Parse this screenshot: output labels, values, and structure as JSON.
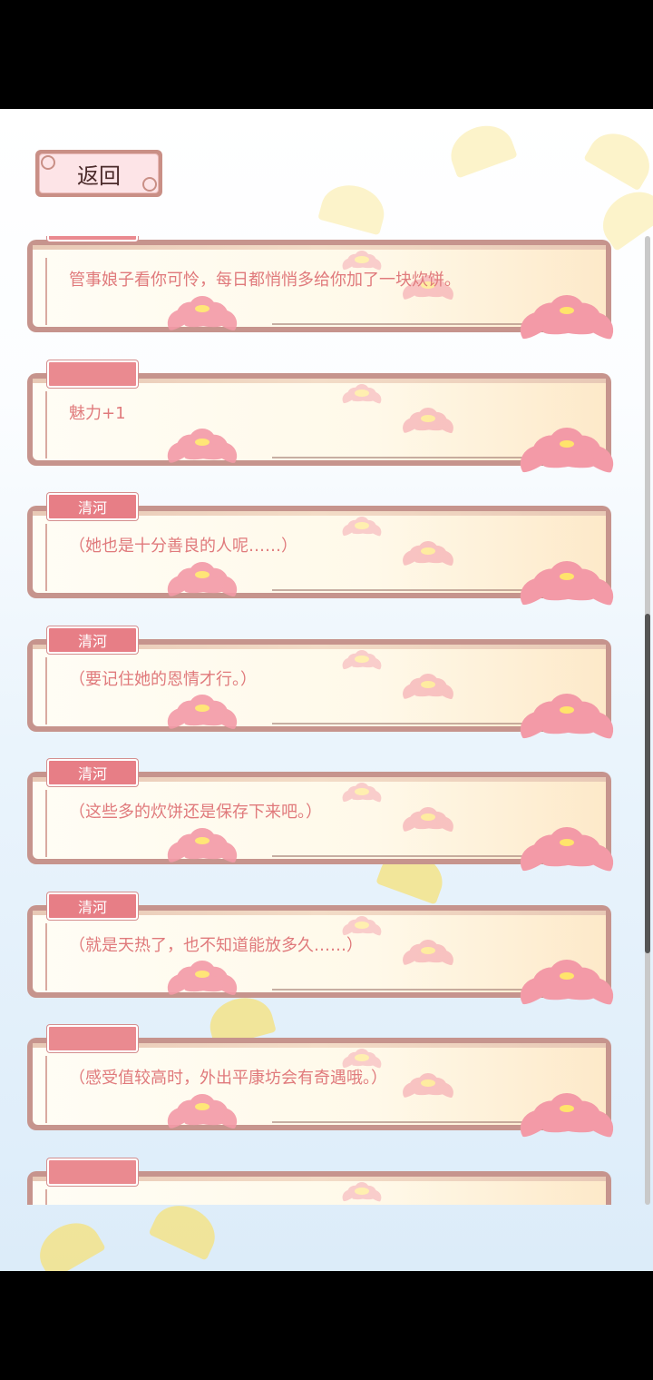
{
  "back_button": {
    "label": "返回"
  },
  "log": {
    "entries": [
      {
        "speaker": "",
        "text": "管事娘子看你可怜，每日都悄悄多给你加了一块炊饼。"
      },
      {
        "speaker": "",
        "text": "魅力+1"
      },
      {
        "speaker": "清河",
        "text": "（她也是十分善良的人呢……）"
      },
      {
        "speaker": "清河",
        "text": "（要记住她的恩情才行。）"
      },
      {
        "speaker": "清河",
        "text": "（这些多的炊饼还是保存下来吧。）"
      },
      {
        "speaker": "清河",
        "text": "（就是天热了，也不知道能放多久……）"
      },
      {
        "speaker": "",
        "text": "（感受值较高时，外出平康坊会有奇遇哦。）"
      },
      {
        "speaker": "",
        "text": ""
      }
    ]
  },
  "scroll": {
    "position": 0.6,
    "visible_fraction": 0.35
  },
  "colors": {
    "tag": "#e77e86",
    "text": "#e07a7c",
    "frame": "#c6948d",
    "back_button": "#fde4e7"
  }
}
